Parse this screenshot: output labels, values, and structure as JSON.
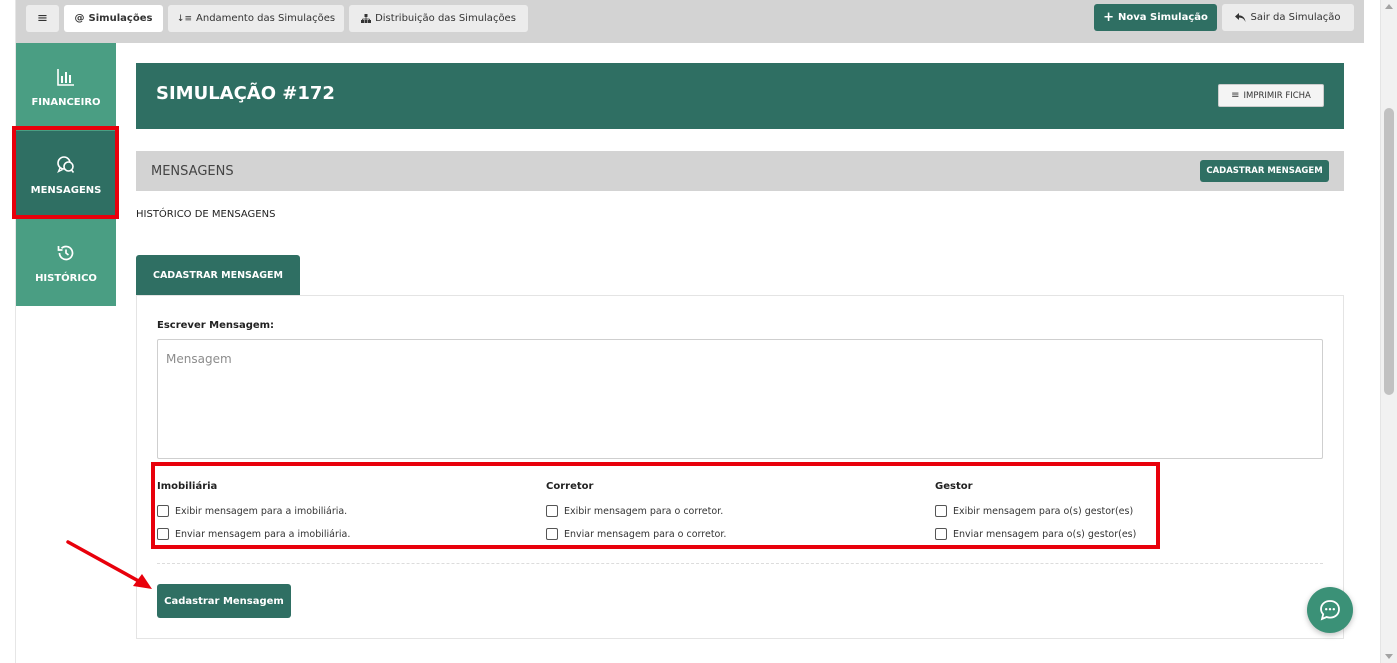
{
  "topbar": {
    "menu_icon": "≡",
    "tabs": [
      {
        "label": "Simulações",
        "icon": "at-icon",
        "glyph": "@"
      },
      {
        "label": "Andamento das Simulações",
        "icon": "sort-icon",
        "glyph": "↓≡"
      },
      {
        "label": "Distribuição das Simulações",
        "icon": "sitemap-icon",
        "glyph": "⛶"
      }
    ],
    "new_simulation": "Nova Simulação",
    "exit_simulation": "Sair da Simulação"
  },
  "sidebar": {
    "items": [
      {
        "label": "FINANCEIRO",
        "icon": "bar-chart-icon"
      },
      {
        "label": "MENSAGENS",
        "icon": "chat-icon"
      },
      {
        "label": "HISTÓRICO",
        "icon": "history-icon"
      }
    ]
  },
  "header": {
    "title": "SIMULAÇÃO #172",
    "print_button": "IMPRIMIR FICHA"
  },
  "messages_bar": {
    "title": "MENSAGENS",
    "button": "CADASTRAR MENSAGEM"
  },
  "history_label": "HISTÓRICO DE MENSAGENS",
  "tab_label": "CADASTRAR MENSAGEM",
  "form": {
    "write_label": "Escrever Mensagem:",
    "placeholder": "Mensagem",
    "columns": [
      {
        "title": "Imobiliária",
        "options": [
          "Exibir mensagem para a imobiliária.",
          "Enviar mensagem para a imobiliária."
        ]
      },
      {
        "title": "Corretor",
        "options": [
          "Exibir mensagem para o corretor.",
          "Enviar mensagem para o corretor."
        ]
      },
      {
        "title": "Gestor",
        "options": [
          "Exibir mensagem para o(s) gestor(es)",
          "Enviar mensagem para o(s) gestor(es)"
        ]
      }
    ],
    "submit": "Cadastrar Mensagem"
  },
  "colors": {
    "primary": "#2f6f63",
    "sidebar": "#4a9e83",
    "highlight": "#e8000b"
  }
}
